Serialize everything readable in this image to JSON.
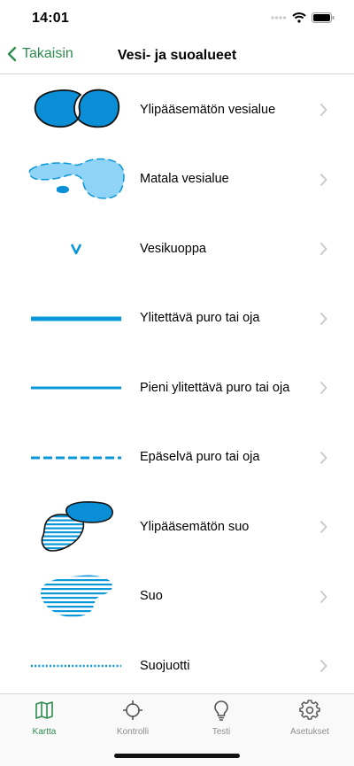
{
  "status": {
    "time": "14:01"
  },
  "nav": {
    "back_label": "Takaisin",
    "title": "Vesi- ja suoalueet"
  },
  "colors": {
    "accent": "#2e8b4f",
    "water_dark": "#0a8fd6",
    "water_light": "#8fd3f7",
    "stream": "#0a98d8"
  },
  "items": [
    {
      "label": "Ylipääsemätön vesialue",
      "icon": "impassable-water-symbol"
    },
    {
      "label": "Matala vesialue",
      "icon": "shallow-water-symbol"
    },
    {
      "label": "Vesikuoppa",
      "icon": "water-pit-symbol"
    },
    {
      "label": "Ylitettävä puro tai oja",
      "icon": "crossable-stream-symbol"
    },
    {
      "label": "Pieni ylitettävä puro tai oja",
      "icon": "small-stream-symbol"
    },
    {
      "label": "Epäselvä puro tai oja",
      "icon": "indistinct-stream-symbol"
    },
    {
      "label": "Ylipääsemätön suo",
      "icon": "impassable-marsh-symbol"
    },
    {
      "label": "Suo",
      "icon": "marsh-symbol"
    },
    {
      "label": "Suojuotti",
      "icon": "narrow-marsh-symbol"
    }
  ],
  "tabs": [
    {
      "label": "Kartta",
      "icon": "map-icon",
      "active": true
    },
    {
      "label": "Kontrolli",
      "icon": "crosshair-icon",
      "active": false
    },
    {
      "label": "Testi",
      "icon": "lightbulb-icon",
      "active": false
    },
    {
      "label": "Asetukset",
      "icon": "gear-icon",
      "active": false
    }
  ]
}
